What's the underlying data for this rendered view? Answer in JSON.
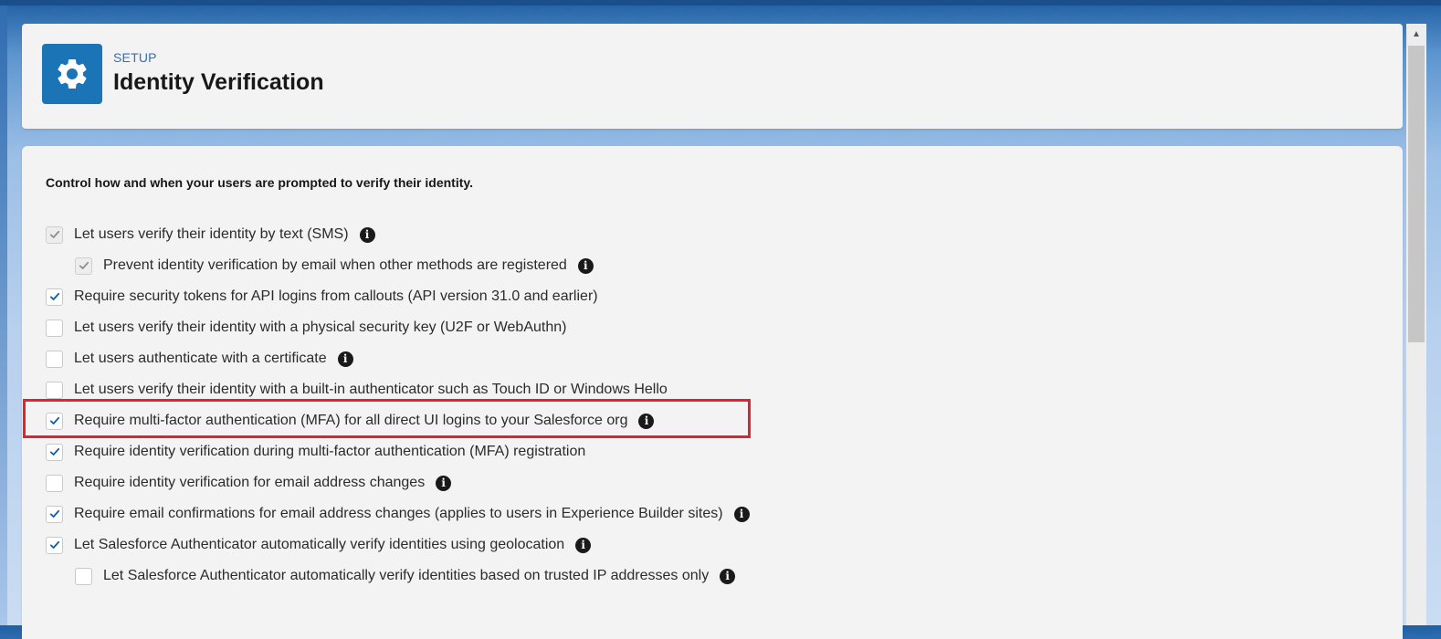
{
  "header": {
    "eyebrow": "SETUP",
    "title": "Identity Verification",
    "icon": "gear-icon"
  },
  "intro": "Control how and when your users are prompted to verify their identity.",
  "options": [
    {
      "label": "Let users verify their identity by text (SMS)",
      "checked": true,
      "disabled": true,
      "indent": false,
      "info": true
    },
    {
      "label": "Prevent identity verification by email when other methods are registered",
      "checked": true,
      "disabled": true,
      "indent": true,
      "info": true
    },
    {
      "label": "Require security tokens for API logins from callouts (API version 31.0 and earlier)",
      "checked": true,
      "disabled": false,
      "indent": false,
      "info": false
    },
    {
      "label": "Let users verify their identity with a physical security key (U2F or WebAuthn)",
      "checked": false,
      "disabled": false,
      "indent": false,
      "info": false
    },
    {
      "label": "Let users authenticate with a certificate",
      "checked": false,
      "disabled": false,
      "indent": false,
      "info": true
    },
    {
      "label": "Let users verify their identity with a built-in authenticator such as Touch ID or Windows Hello",
      "checked": false,
      "disabled": false,
      "indent": false,
      "info": false
    },
    {
      "label": "Require multi-factor authentication (MFA) for all direct UI logins to your Salesforce org",
      "checked": true,
      "disabled": false,
      "indent": false,
      "info": true,
      "highlighted": true
    },
    {
      "label": "Require identity verification during multi-factor authentication (MFA) registration",
      "checked": true,
      "disabled": false,
      "indent": false,
      "info": false
    },
    {
      "label": "Require identity verification for email address changes",
      "checked": false,
      "disabled": false,
      "indent": false,
      "info": true
    },
    {
      "label": "Require email confirmations for email address changes (applies to users in Experience Builder sites)",
      "checked": true,
      "disabled": false,
      "indent": false,
      "info": true
    },
    {
      "label": "Let Salesforce Authenticator automatically verify identities using geolocation",
      "checked": true,
      "disabled": false,
      "indent": false,
      "info": true
    },
    {
      "label": "Let Salesforce Authenticator automatically verify identities based on trusted IP addresses only",
      "checked": false,
      "disabled": false,
      "indent": true,
      "info": true
    }
  ],
  "colors": {
    "brand_blue": "#1b74b5",
    "check_blue": "#0b5cab",
    "check_disabled": "#8c8c8c",
    "highlight_red": "#e0242f"
  }
}
